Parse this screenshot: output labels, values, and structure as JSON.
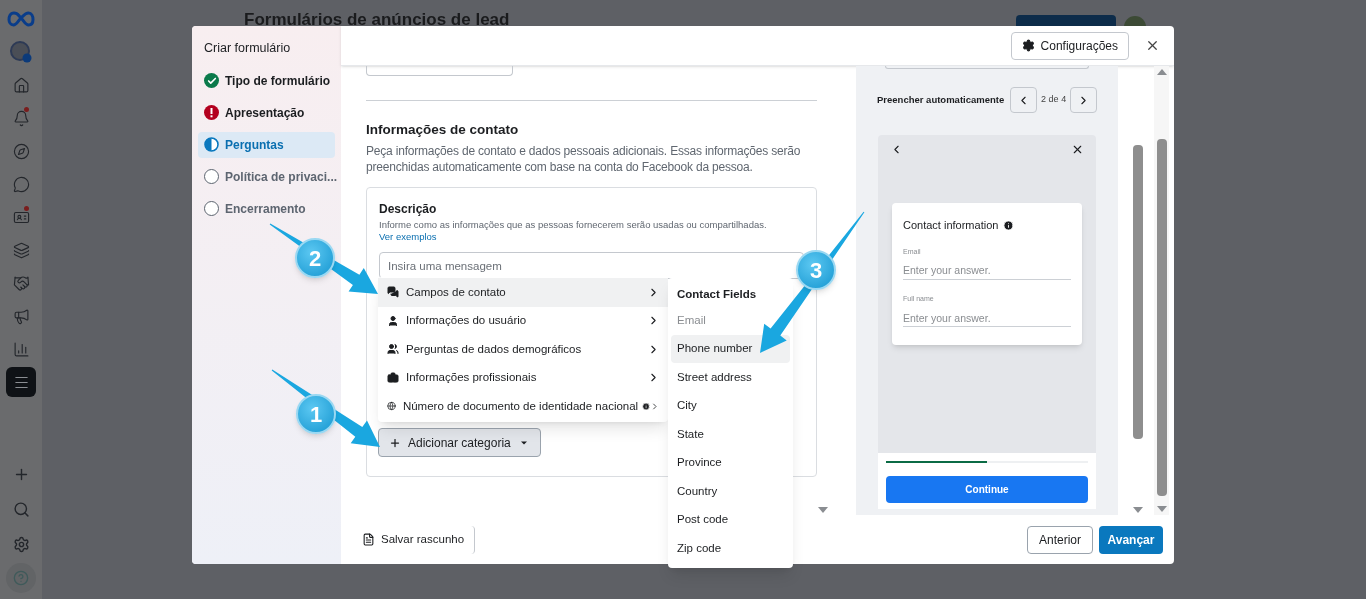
{
  "page": {
    "title": "Formulários de anúncios de lead"
  },
  "left_rail": {
    "items": [
      {
        "selected": false,
        "dot": false
      },
      {
        "selected": false,
        "dot": false
      },
      {
        "selected": false,
        "dot": false
      },
      {
        "selected": false,
        "dot": true
      },
      {
        "selected": false,
        "dot": false
      },
      {
        "selected": false,
        "dot": false
      },
      {
        "selected": false,
        "dot": true
      },
      {
        "selected": false,
        "dot": false
      },
      {
        "selected": false,
        "dot": false
      },
      {
        "selected": false,
        "dot": false
      },
      {
        "selected": false,
        "dot": false
      },
      {
        "selected": true,
        "dot": false
      }
    ]
  },
  "dialog": {
    "sidebar": {
      "title": "Criar formulário",
      "steps": [
        {
          "label": "Tipo de formulário",
          "kind": "done",
          "selected": false
        },
        {
          "label": "Apresentação",
          "kind": "error",
          "selected": false
        },
        {
          "label": "Perguntas",
          "kind": "current",
          "selected": true
        },
        {
          "label": "Política de privaci...",
          "kind": "todo",
          "selected": false
        },
        {
          "label": "Encerramento",
          "kind": "todo",
          "selected": false
        }
      ]
    },
    "settings_button": "Configurações",
    "section": {
      "title": "Informações de contato",
      "description": "Peça informações de contato e dados pessoais adicionais. Essas informações serão preenchidas automaticamente com base na conta do Facebook da pessoa.",
      "card": {
        "label": "Descrição",
        "hint": "Informe como as informações que as pessoas fornecerem serão usadas ou compartilhadas.",
        "link": "Ver exemplos",
        "placeholder": "Insira uma mensagem"
      },
      "add_category_button": "Adicionar categoria"
    },
    "category_menu": {
      "items": [
        {
          "label": "Campos de contato",
          "selected": true,
          "info": false
        },
        {
          "label": "Informações do usuário",
          "selected": false,
          "info": false
        },
        {
          "label": "Perguntas de dados demográficos",
          "selected": false,
          "info": false
        },
        {
          "label": "Informações profissionais",
          "selected": false,
          "info": false
        },
        {
          "label": "Número de documento de identidade nacional",
          "selected": false,
          "info": true
        }
      ]
    },
    "submenu": {
      "title": "Contact Fields",
      "items": [
        {
          "label": "Email",
          "disabled": true,
          "selected": false
        },
        {
          "label": "Phone number",
          "disabled": false,
          "selected": true
        },
        {
          "label": "Street address",
          "disabled": false,
          "selected": false
        },
        {
          "label": "City",
          "disabled": false,
          "selected": false
        },
        {
          "label": "State",
          "disabled": false,
          "selected": false
        },
        {
          "label": "Province",
          "disabled": false,
          "selected": false
        },
        {
          "label": "Country",
          "disabled": false,
          "selected": false
        },
        {
          "label": "Post code",
          "disabled": false,
          "selected": false
        },
        {
          "label": "Zip code",
          "disabled": false,
          "selected": false
        }
      ]
    },
    "preview": {
      "autofill_label": "Preencher automaticamente",
      "page_indicator": "2 de 4",
      "form": {
        "title": "Contact information",
        "fields": [
          {
            "label": "Email",
            "placeholder": "Enter your answer."
          },
          {
            "label": "Full name",
            "placeholder": "Enter your answer."
          }
        ]
      },
      "progress": {
        "level": 0.5
      },
      "continue_button": "Continue"
    },
    "footer": {
      "save_draft": "Salvar rascunho",
      "back": "Anterior",
      "next": "Avançar"
    }
  },
  "callouts": [
    {
      "label": "1"
    },
    {
      "label": "2"
    },
    {
      "label": "3"
    }
  ]
}
